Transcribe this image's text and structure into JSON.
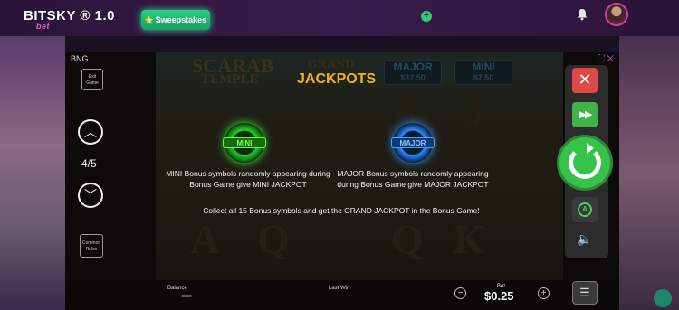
{
  "header": {
    "brand": "BITSKY",
    "brand_sub": "bet",
    "version": "® 1.0",
    "sweepstakes_label": "Sweepstakes",
    "add_icon": "plus-circle-icon",
    "bell_icon": "bell-icon"
  },
  "game": {
    "provider": "BNG",
    "exit_label": "Exit Game",
    "rules_label": "Common Rules",
    "page_indicator": "4/5",
    "background": {
      "title_line1": "SCARAB",
      "title_line2": "TEMPLE",
      "grand_label": "GRAND",
      "major_label": "MAJOR",
      "major_value": "$37.50",
      "mini_label": "MINI",
      "mini_value": "$7.50"
    },
    "paytable": {
      "title": "JACKPOTS",
      "mini_coin_label": "MINI",
      "major_coin_label": "MAJOR",
      "mini_desc": "MINI Bonus symbols randomly appearing during Bonus Game give MINI JACKPOT",
      "major_desc": "MAJOR Bonus symbols randomly appearing during Bonus Game give MAJOR JACKPOT",
      "grand_desc": "Collect all 15 Bonus symbols and get the GRAND JACKPOT in the Bonus Game!"
    },
    "bottom": {
      "balance_label": "Balance",
      "last_win_label": "Last Win",
      "bet_label": "Bet",
      "bet_value": "$0.25"
    },
    "colors": {
      "jackpot_title": "#f3b01c",
      "spin_green": "#37c24a",
      "close_red": "#e04848"
    }
  }
}
